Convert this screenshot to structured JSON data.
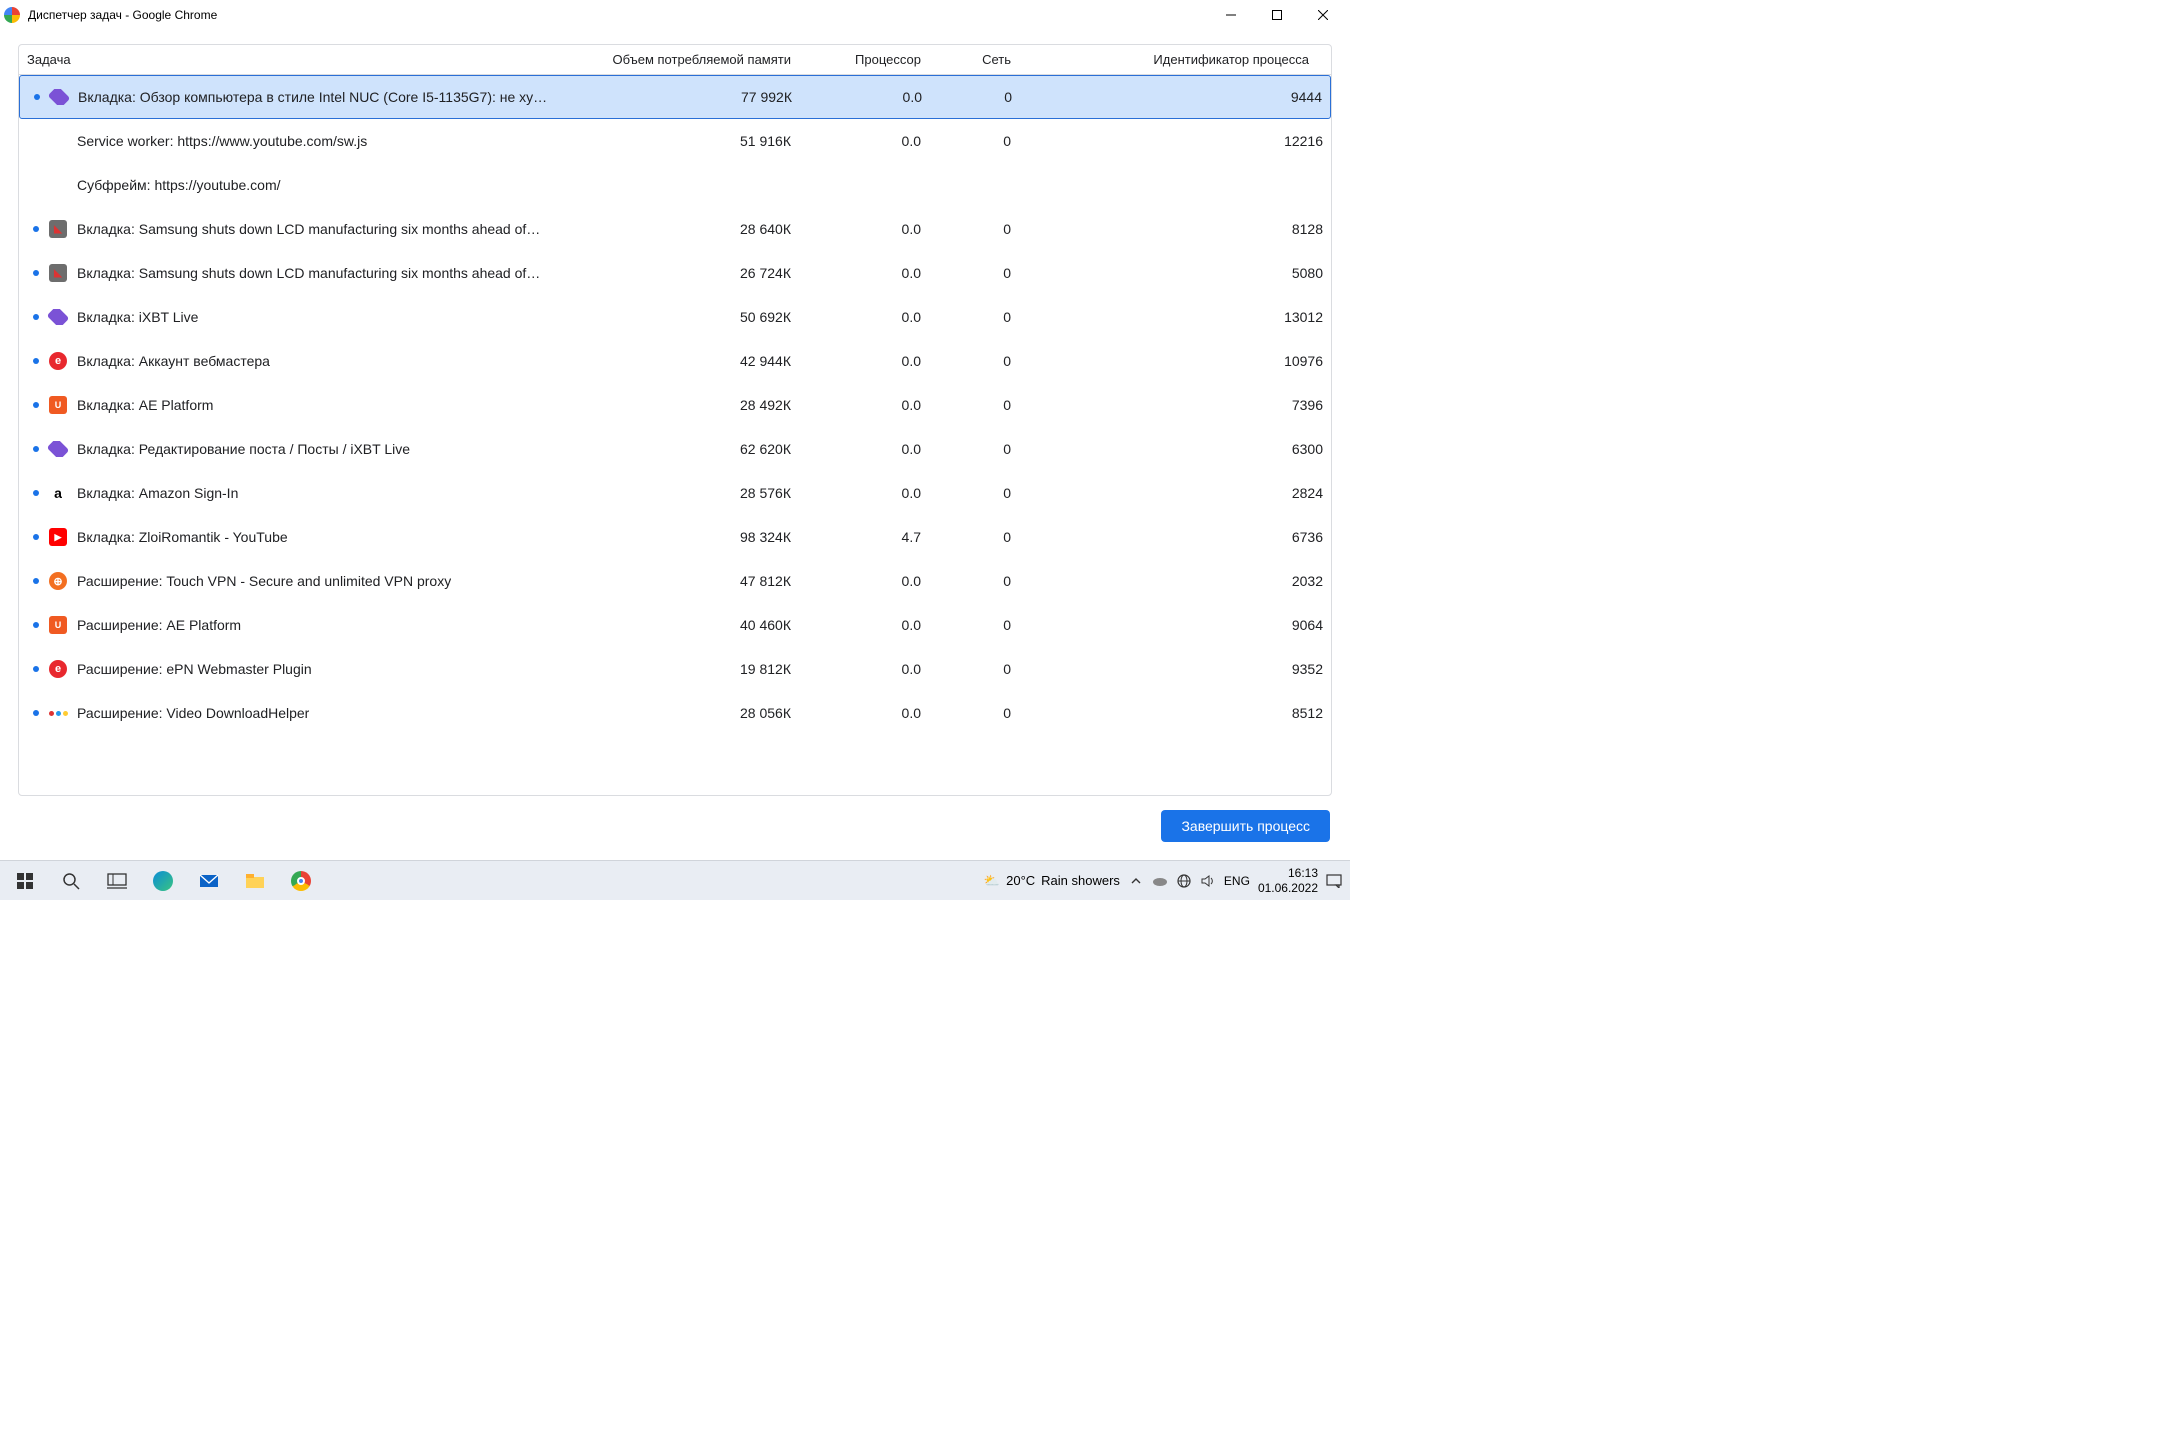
{
  "window": {
    "title": "Диспетчер задач - Google Chrome"
  },
  "columns": {
    "task": "Задача",
    "memory": "Объем потребляемой памяти",
    "cpu": "Процессор",
    "network": "Сеть",
    "pid": "Идентификатор процесса"
  },
  "end_process_label": "Завершить процесс",
  "rows": [
    {
      "selected": true,
      "bullet": true,
      "icon": "diamond-purple",
      "icon_glyph": "◆",
      "task": "Вкладка: Обзор компьютера в стиле Intel NUC (Core I5-1135G7): не ху…",
      "memory": "77 992К",
      "cpu": "0.0",
      "network": "0",
      "pid": "9444"
    },
    {
      "selected": false,
      "bullet": false,
      "icon": "none",
      "icon_glyph": "",
      "task": "Service worker: https://www.youtube.com/sw.js",
      "memory": "51 916К",
      "cpu": "0.0",
      "network": "0",
      "pid": "12216"
    },
    {
      "selected": false,
      "bullet": false,
      "icon": "none",
      "icon_glyph": "",
      "task": "Субфрейм: https://youtube.com/",
      "memory": "",
      "cpu": "",
      "network": "",
      "pid": ""
    },
    {
      "selected": false,
      "bullet": true,
      "icon": "grey-square",
      "icon_glyph": "▣",
      "task": "Вкладка: Samsung shuts down LCD manufacturing six months ahead of…",
      "memory": "28 640К",
      "cpu": "0.0",
      "network": "0",
      "pid": "8128"
    },
    {
      "selected": false,
      "bullet": true,
      "icon": "grey-square",
      "icon_glyph": "▣",
      "task": "Вкладка: Samsung shuts down LCD manufacturing six months ahead of…",
      "memory": "26 724К",
      "cpu": "0.0",
      "network": "0",
      "pid": "5080"
    },
    {
      "selected": false,
      "bullet": true,
      "icon": "diamond-purple",
      "icon_glyph": "◆",
      "task": "Вкладка: iXBT Live",
      "memory": "50 692К",
      "cpu": "0.0",
      "network": "0",
      "pid": "13012"
    },
    {
      "selected": false,
      "bullet": true,
      "icon": "red-circle-e",
      "icon_glyph": "e",
      "task": "Вкладка: Аккаунт вебмастера",
      "memory": "42 944К",
      "cpu": "0.0",
      "network": "0",
      "pid": "10976"
    },
    {
      "selected": false,
      "bullet": true,
      "icon": "orange-aep",
      "icon_glyph": "U",
      "task": "Вкладка: AE Platform",
      "memory": "28 492К",
      "cpu": "0.0",
      "network": "0",
      "pid": "7396"
    },
    {
      "selected": false,
      "bullet": true,
      "icon": "diamond-purple",
      "icon_glyph": "◆",
      "task": "Вкладка: Редактирование поста / Посты / iXBT Live",
      "memory": "62 620К",
      "cpu": "0.0",
      "network": "0",
      "pid": "6300"
    },
    {
      "selected": false,
      "bullet": true,
      "icon": "amazon",
      "icon_glyph": "a",
      "task": "Вкладка: Amazon Sign-In",
      "memory": "28 576К",
      "cpu": "0.0",
      "network": "0",
      "pid": "2824"
    },
    {
      "selected": false,
      "bullet": true,
      "icon": "youtube",
      "icon_glyph": "▶",
      "task": "Вкладка: ZloiRomantik - YouTube",
      "memory": "98 324К",
      "cpu": "4.7",
      "network": "0",
      "pid": "6736"
    },
    {
      "selected": false,
      "bullet": true,
      "icon": "globe-orange",
      "icon_glyph": "⊕",
      "task": "Расширение: Touch VPN - Secure and unlimited VPN proxy",
      "memory": "47 812К",
      "cpu": "0.0",
      "network": "0",
      "pid": "2032"
    },
    {
      "selected": false,
      "bullet": true,
      "icon": "orange-aep",
      "icon_glyph": "U",
      "task": "Расширение: AE Platform",
      "memory": "40 460К",
      "cpu": "0.0",
      "network": "0",
      "pid": "9064"
    },
    {
      "selected": false,
      "bullet": true,
      "icon": "red-circle-e",
      "icon_glyph": "e",
      "task": "Расширение: ePN Webmaster Plugin",
      "memory": "19 812К",
      "cpu": "0.0",
      "network": "0",
      "pid": "9352"
    },
    {
      "selected": false,
      "bullet": true,
      "icon": "vdh",
      "icon_glyph": "",
      "task": "Расширение: Video DownloadHelper",
      "memory": "28 056К",
      "cpu": "0.0",
      "network": "0",
      "pid": "8512"
    }
  ],
  "taskbar": {
    "weather_temp": "20°C",
    "weather_cond": "Rain showers",
    "lang": "ENG",
    "time": "16:13",
    "date": "01.06.2022"
  }
}
